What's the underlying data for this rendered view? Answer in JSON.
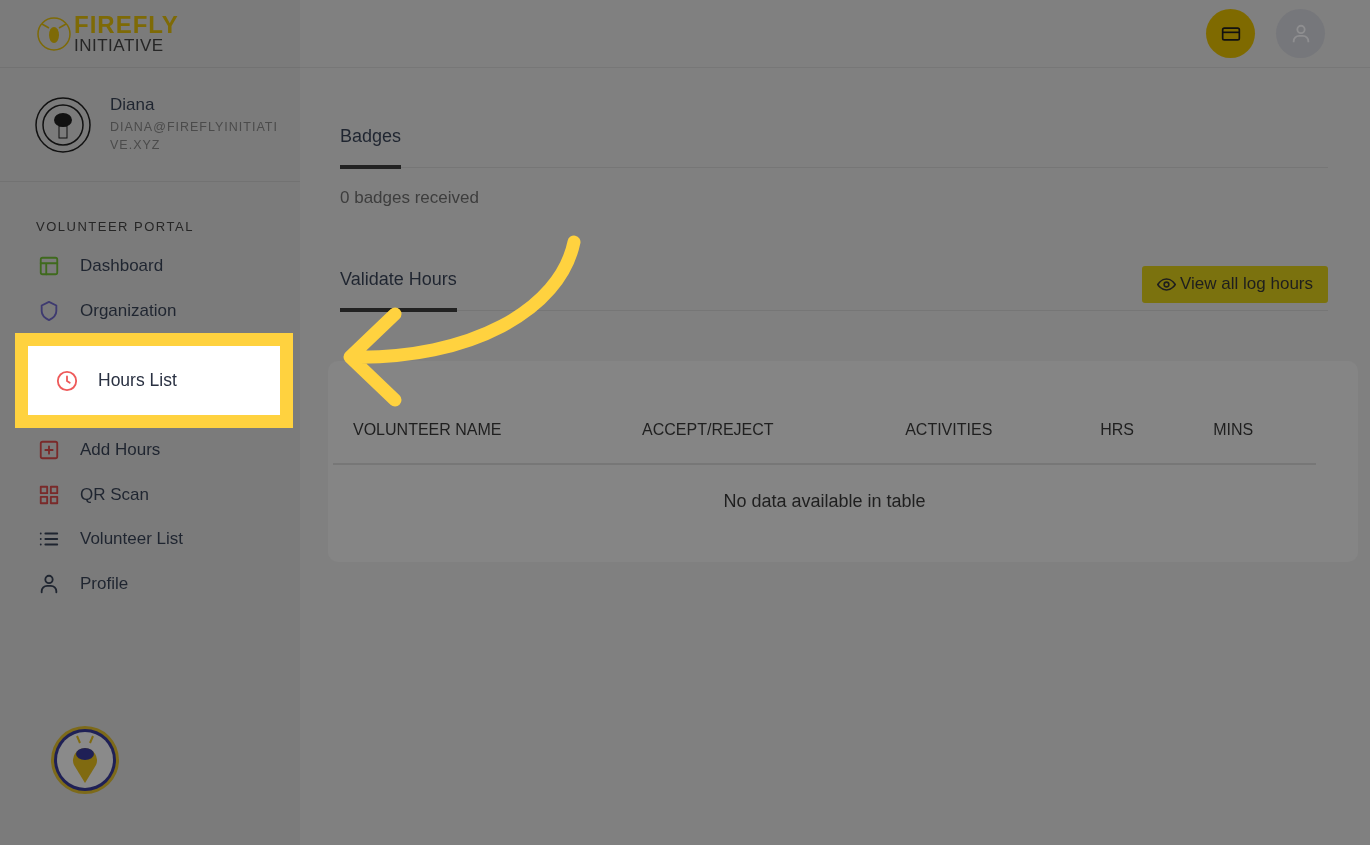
{
  "logo": {
    "line1": "FIREFLY",
    "line2": "INITIATIVE"
  },
  "user": {
    "name": "Diana",
    "email": "DIANA@FIREFLYINITIATIVE.XYZ"
  },
  "sidebar": {
    "section": "VOLUNTEER PORTAL",
    "items": [
      {
        "label": "Dashboard",
        "highlighted": false
      },
      {
        "label": "Organization",
        "highlighted": false
      },
      {
        "label": "Hours List",
        "highlighted": true
      },
      {
        "label": "Add Hours",
        "highlighted": false
      },
      {
        "label": "QR Scan",
        "highlighted": false
      },
      {
        "label": "Volunteer List",
        "highlighted": false
      },
      {
        "label": "Profile",
        "highlighted": false
      }
    ]
  },
  "badges": {
    "title": "Badges",
    "text": "0 badges received"
  },
  "validate": {
    "title": "Validate Hours",
    "button": "View all log hours"
  },
  "table": {
    "columns": [
      "VOLUNTEER NAME",
      "ACCEPT/REJECT",
      "ACTIVITIES",
      "HRS",
      "MINS"
    ],
    "empty": "No data available in table"
  }
}
